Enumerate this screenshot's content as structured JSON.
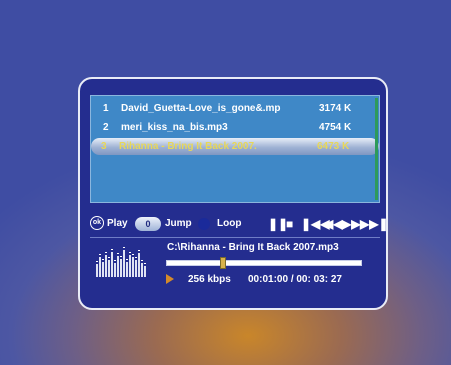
{
  "playlist": {
    "items": [
      {
        "num": "1",
        "name": "David_Guetta-Love_is_gone&.mp",
        "size": "3174 K"
      },
      {
        "num": "2",
        "name": "meri_kiss_na_bis.mp3",
        "size": "4754 K"
      },
      {
        "num": "3",
        "name": "Rihanna - Bring It Back 2007.",
        "size": "6473 K"
      }
    ],
    "selected_index": 2
  },
  "controls": {
    "ok_icon_label": "ok",
    "play_label": "Play",
    "jump_badge": "0",
    "jump_label": "Jump",
    "loop_label": "Loop",
    "transport_icons": [
      "pause-icon",
      "stop-icon",
      "skip-previous-icon",
      "rewind-icon",
      "fast-forward-icon",
      "skip-next-icon"
    ]
  },
  "now_playing": {
    "path": "C:\\Rihanna - Bring It Back 2007.mp3",
    "bitrate": "256 kbps",
    "elapsed": "00:01:00",
    "separator": "/",
    "total": "00: 03: 27",
    "progress_fraction": 0.29
  },
  "equalizer": {
    "levels": [
      0.45,
      0.7,
      0.55,
      0.8,
      0.6,
      0.9,
      0.5,
      0.75,
      0.65,
      0.95,
      0.55,
      0.8,
      0.7,
      0.6,
      0.85,
      0.5,
      0.4
    ]
  },
  "colors": {
    "panel": "#242d8f",
    "playlist_bg": "#3f88c7",
    "selected_text": "#e7d75a",
    "accent_play": "#d48a2a"
  }
}
